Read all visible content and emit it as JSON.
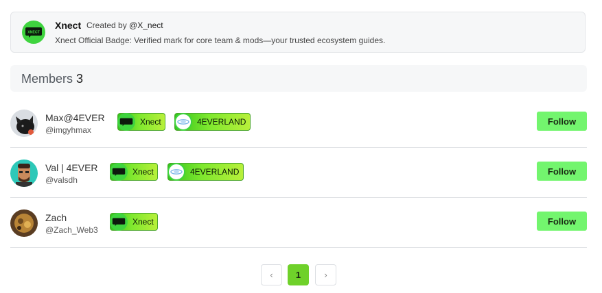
{
  "group": {
    "name": "Xnect",
    "created_by_prefix": "Created by",
    "created_by_handle": "@X_nect",
    "description": "Xnect Official Badge: Verified mark for core team & mods—your trusted ecosystem guides."
  },
  "members": {
    "label": "Members",
    "count": "3",
    "list": [
      {
        "name": "Max@4EVER",
        "handle": "@imgyhmax",
        "badges": [
          "Xnect",
          "4EVERLAND"
        ],
        "follow": "Follow"
      },
      {
        "name": "Val | 4EVER",
        "handle": "@valsdh",
        "badges": [
          "Xnect",
          "4EVERLAND"
        ],
        "follow": "Follow"
      },
      {
        "name": "Zach",
        "handle": "@Zach_Web3",
        "badges": [
          "Xnect"
        ],
        "follow": "Follow"
      }
    ]
  },
  "pagination": {
    "prev": "‹",
    "current": "1",
    "next": "›"
  },
  "logo_text": "XNECT",
  "colors": {
    "accent": "#73f56e",
    "badge_green": "#3fd43f",
    "current_page": "#6fd12a"
  }
}
